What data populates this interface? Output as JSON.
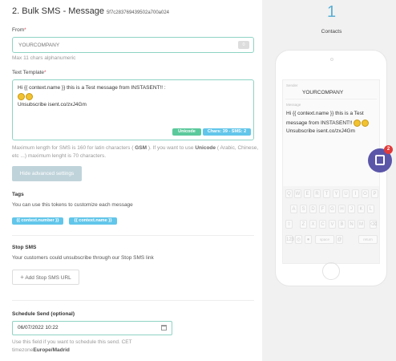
{
  "page": {
    "title": "2. Bulk SMS - Message",
    "id": "5f7c2837694395​02a700a024"
  },
  "from": {
    "label": "From",
    "required_mark": "*",
    "value": "YOURCOMPANY",
    "count": "0",
    "hint": "Max 11 chars alphanumeric"
  },
  "template": {
    "label": "Text Template",
    "required_mark": "*",
    "line1": "Hi {{ context.name }} this is a Test message from INSTASENT!! :",
    "line2": "Unsubscribe isent.co/zxJ4Gm",
    "unicode_pill": "Unicode",
    "chars_pill": "Chars: 39 - SMS: 2",
    "hint_part1": "Maximum length for SMS is 160 for latin characters (",
    "hint_gsm": "GSM",
    "hint_part2": "). If you want to use",
    "hint_unicode": "Unicode",
    "hint_part3": "( Arabic, Chinese,",
    "hint_line2": "etc ...) maximum lenght is 70 characters."
  },
  "advanced_button": "Hide advanced settings",
  "tags": {
    "label": "Tags",
    "hint": "You can use this tokens to customize each message",
    "items": [
      "{{ context.number }}",
      "{{ context.name }}"
    ]
  },
  "stop_sms": {
    "label": "Stop SMS",
    "hint": "Your customers could unsubscribe through our Stop SMS link",
    "button": "Add Stop SMS URL",
    "button_icon": "+"
  },
  "schedule": {
    "label": "Schedule Send (optional)",
    "value": "06/07/2022 10:22",
    "hint_line1": "Use this field if you want to schedule this send. CET",
    "hint_line2_prefix": "timezone",
    "hint_timezone": "Europe/Madrid"
  },
  "preview": {
    "contacts_count": "1",
    "contacts_label": "Contacts",
    "sender_label": "Sender",
    "sender_value": "YOURCOMPANY",
    "message_label": "Message",
    "msg_line1": "Hi {{ context.name }} this is a Test",
    "msg_line2": "message from INSTASENT!!",
    "msg_line3": "Unsubscribe isent.co/zxJ4Gm",
    "keyboard": {
      "row1": [
        "Q",
        "W",
        "E",
        "R",
        "T",
        "Y",
        "U",
        "I",
        "O",
        "P"
      ],
      "row2": [
        "A",
        "S",
        "D",
        "F",
        "G",
        "H",
        "J",
        "K",
        "L"
      ],
      "row3": [
        "Z",
        "X",
        "C",
        "V",
        "B",
        "N",
        "M"
      ],
      "space": "space",
      "return": "return"
    }
  },
  "chat_badge": "2",
  "colors": {
    "accent_teal": "#8fd3c4",
    "pill_green": "#5cc99c",
    "pill_blue": "#62c6ea",
    "contacts_blue": "#5aaed4",
    "chat_purple": "#5b56a8"
  }
}
